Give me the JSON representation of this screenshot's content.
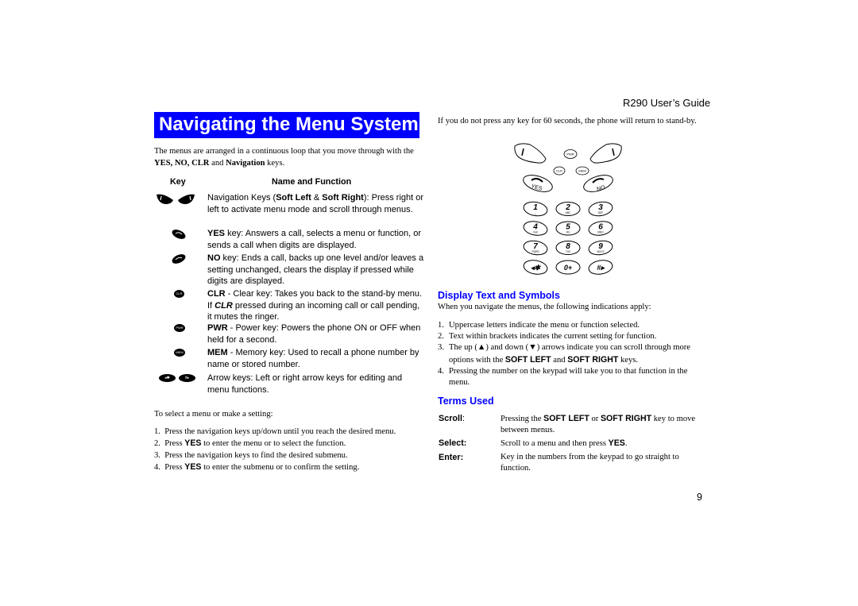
{
  "left": {
    "title": "Navigating the Menu System",
    "intro": {
      "pre": "The menus are arranged in a continuous loop that you move through with the ",
      "bold1": "YES, NO, CLR",
      "mid": " and ",
      "bold2": "Navigation",
      "post": " keys."
    },
    "table": {
      "col_key": "Key",
      "col_name": "Name and Function",
      "rows": [
        {
          "icon": "soft-left-right-keys",
          "desc_pre": "Navigation Keys (",
          "b1": "Soft Left",
          "mid": " & ",
          "b2": "Soft Right",
          "desc_post": "): Press right or left to activate menu mode and scroll through menus."
        },
        {
          "icon": "yes-key",
          "bold": "YES",
          "desc": " key: Answers a call, selects a menu or function, or sends a call when digits are displayed."
        },
        {
          "icon": "no-key",
          "bold": "NO",
          "desc": " key: Ends a call, backs up one level and/or leaves a setting unchanged, clears the display if pressed while digits are displayed."
        },
        {
          "icon": "clr-key",
          "icon_label": "CLR",
          "bold": "CLR",
          "desc_a": " - Clear key: Takes you back to the stand-by menu. If ",
          "italic": "CLR",
          "desc_b": " pressed during an incoming call or call pending, it mutes the ringer."
        },
        {
          "icon": "pwr-key",
          "icon_label": "PWR",
          "bold": "PWR",
          "desc": " - Power key: Powers the phone ON or OFF when held for a second."
        },
        {
          "icon": "mem-key",
          "icon_label": "MEM",
          "bold": "MEM",
          "desc": " - Memory key: Used to recall a phone number by name or stored number."
        },
        {
          "icon": "arrow-keys",
          "icon_label_left": "◂✱",
          "icon_label_right": "#▸",
          "desc": "Arrow keys: Left or right arrow keys for editing and menu functions."
        }
      ]
    },
    "select_intro": "To select a menu or make a setting:",
    "steps": [
      {
        "n": "1.",
        "pre": "Press the navigation keys up/down until you reach the desired menu.",
        "bold": "",
        "post": ""
      },
      {
        "n": "2.",
        "pre": "Press ",
        "bold": "YES",
        "post": " to enter the menu or to select the function."
      },
      {
        "n": "3.",
        "pre": "Press the navigation keys to find the desired submenu.",
        "bold": "",
        "post": ""
      },
      {
        "n": "4.",
        "pre": "Press ",
        "bold": "YES",
        "post": " to enter the submenu or to confirm the setting."
      }
    ]
  },
  "right": {
    "header": "R290 User’s Guide",
    "timeout_text": "If you do not press any key for 60 seconds, the phone will return to stand-by.",
    "keypad": {
      "top_keys": [
        "PWR",
        "CLR",
        "MEM",
        "YES",
        "NO"
      ],
      "digits": [
        {
          "main": "1",
          "sub": "␣"
        },
        {
          "main": "2",
          "sub": "ABC"
        },
        {
          "main": "3",
          "sub": "DEF"
        },
        {
          "main": "4",
          "sub": "GHI"
        },
        {
          "main": "5",
          "sub": "JKL"
        },
        {
          "main": "6",
          "sub": "MNO"
        },
        {
          "main": "7",
          "sub": "PQRS"
        },
        {
          "main": "8",
          "sub": "TUV"
        },
        {
          "main": "9",
          "sub": "WXYZ"
        },
        {
          "main": "◂✱",
          "sub": ""
        },
        {
          "main": "0+",
          "sub": ""
        },
        {
          "main": "#▸",
          "sub": ""
        }
      ]
    },
    "display_heading": "Display Text and Symbols",
    "display_intro": "When you navigate the menus, the following indications apply:",
    "display_items": [
      {
        "n": "1.",
        "parts": [
          {
            "t": "Uppercase letters indicate the menu or function selected."
          }
        ]
      },
      {
        "n": "2.",
        "parts": [
          {
            "t": "Text within brackets indicates the current setting for function."
          }
        ]
      },
      {
        "n": "3.",
        "parts": [
          {
            "t": "The up (▲) and down (▼) arrows indicate you can scroll through more options with the "
          },
          {
            "b": "SOFT LEFT"
          },
          {
            "t": " and "
          },
          {
            "b": "SOFT RIGHT"
          },
          {
            "t": " keys."
          }
        ]
      },
      {
        "n": "4.",
        "parts": [
          {
            "t": "Pressing the number on the keypad will take you to that function in the menu."
          }
        ]
      }
    ],
    "terms_heading": "Terms Used",
    "terms": [
      {
        "term": "Scroll",
        "suffix": ":",
        "parts": [
          {
            "t": "Pressing the "
          },
          {
            "b": "SOFT LEFT"
          },
          {
            "t": " or "
          },
          {
            "b": "SOFT RIGHT"
          },
          {
            "t": " key to move between menus."
          }
        ]
      },
      {
        "term": "Select:",
        "suffix": "",
        "parts": [
          {
            "t": "Scroll to a menu and then press "
          },
          {
            "b": "YES"
          },
          {
            "t": "."
          }
        ]
      },
      {
        "term": "Enter:",
        "suffix": "",
        "parts": [
          {
            "t": "Key in the numbers from the keypad to go straight to function."
          }
        ]
      }
    ],
    "page_number": "9"
  },
  "colors": {
    "heading_blue": "#0000ff",
    "title_bar_bg": "#0000ff",
    "title_text": "#ffffff"
  }
}
